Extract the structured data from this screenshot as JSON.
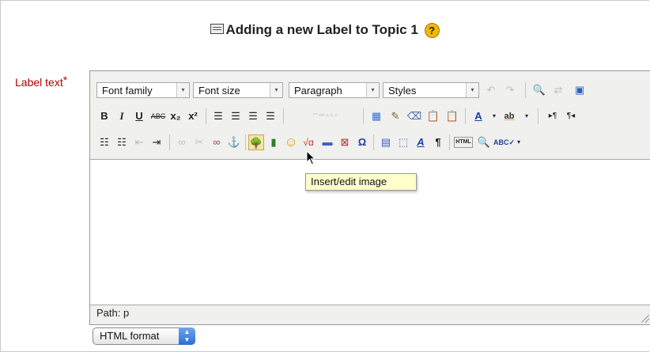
{
  "page": {
    "title": "Adding a new Label to Topic 1"
  },
  "form": {
    "label_text": "Label text",
    "required_mark": "*"
  },
  "editor": {
    "dropdowns": {
      "font_family": "Font family",
      "font_size": "Font size",
      "format": "Paragraph",
      "styles": "Styles"
    },
    "buttons": {
      "bold": "B",
      "italic": "I",
      "underline": "U",
      "strike": "ABC",
      "subscript": "x₂",
      "superscript": "x²",
      "omega": "Ω",
      "pilcrow": "¶",
      "html": "HTML",
      "anchor": "⚓",
      "smiley": "☺"
    },
    "tooltip": "Insert/edit image",
    "path": "Path: p"
  },
  "format_select": {
    "value": "HTML format"
  }
}
